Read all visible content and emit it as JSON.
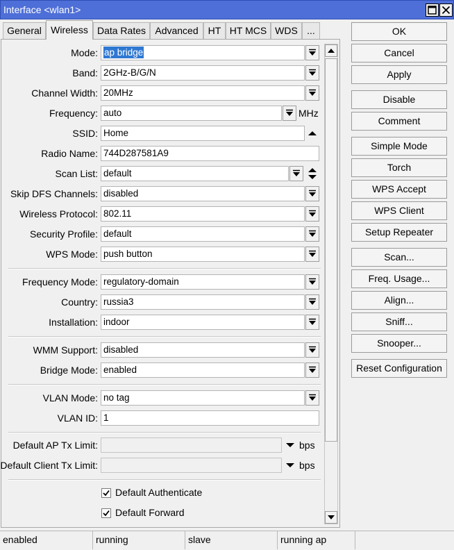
{
  "window": {
    "title": "Interface <wlan1>",
    "icons": [
      "maximize-icon",
      "close-icon"
    ]
  },
  "tabs": [
    {
      "label": "General",
      "active": false
    },
    {
      "label": "Wireless",
      "active": true
    },
    {
      "label": "Data Rates",
      "active": false
    },
    {
      "label": "Advanced",
      "active": false
    },
    {
      "label": "HT",
      "active": false
    },
    {
      "label": "HT MCS",
      "active": false
    },
    {
      "label": "WDS",
      "active": false
    },
    {
      "label": "...",
      "active": false
    }
  ],
  "form": {
    "mode": {
      "label": "Mode:",
      "value": "ap bridge"
    },
    "band": {
      "label": "Band:",
      "value": "2GHz-B/G/N"
    },
    "channel_width": {
      "label": "Channel Width:",
      "value": "20MHz"
    },
    "frequency": {
      "label": "Frequency:",
      "value": "auto",
      "unit": "MHz"
    },
    "ssid": {
      "label": "SSID:",
      "value": "Home"
    },
    "radio_name": {
      "label": "Radio Name:",
      "value": "744D287581A9"
    },
    "scan_list": {
      "label": "Scan List:",
      "value": "default"
    },
    "skip_dfs": {
      "label": "Skip DFS Channels:",
      "value": "disabled"
    },
    "wireless_protocol": {
      "label": "Wireless Protocol:",
      "value": "802.11"
    },
    "security_profile": {
      "label": "Security Profile:",
      "value": "default"
    },
    "wps_mode": {
      "label": "WPS Mode:",
      "value": "push button"
    },
    "frequency_mode": {
      "label": "Frequency Mode:",
      "value": "regulatory-domain"
    },
    "country": {
      "label": "Country:",
      "value": "russia3"
    },
    "installation": {
      "label": "Installation:",
      "value": "indoor"
    },
    "wmm_support": {
      "label": "WMM Support:",
      "value": "disabled"
    },
    "bridge_mode": {
      "label": "Bridge Mode:",
      "value": "enabled"
    },
    "vlan_mode": {
      "label": "VLAN Mode:",
      "value": "no tag"
    },
    "vlan_id": {
      "label": "VLAN ID:",
      "value": "1"
    },
    "default_ap_tx_limit": {
      "label": "Default AP Tx Limit:",
      "value": "",
      "unit": "bps"
    },
    "default_client_tx_limit": {
      "label": "Default Client Tx Limit:",
      "value": "",
      "unit": "bps"
    },
    "default_authenticate": {
      "label": "Default Authenticate",
      "checked": true
    },
    "default_forward": {
      "label": "Default Forward",
      "checked": true
    }
  },
  "buttons": {
    "ok": "OK",
    "cancel": "Cancel",
    "apply": "Apply",
    "disable": "Disable",
    "comment": "Comment",
    "simple_mode": "Simple Mode",
    "torch": "Torch",
    "wps_accept": "WPS Accept",
    "wps_client": "WPS Client",
    "setup_repeater": "Setup Repeater",
    "scan": "Scan...",
    "freq_usage": "Freq. Usage...",
    "align": "Align...",
    "sniff": "Sniff...",
    "snooper": "Snooper...",
    "reset_configuration": "Reset Configuration"
  },
  "status": [
    "enabled",
    "running",
    "slave",
    "running ap",
    ""
  ],
  "colors": {
    "titlebar": "#4e6fd8",
    "selection": "#2f78d2",
    "background": "#f0f0f0"
  }
}
